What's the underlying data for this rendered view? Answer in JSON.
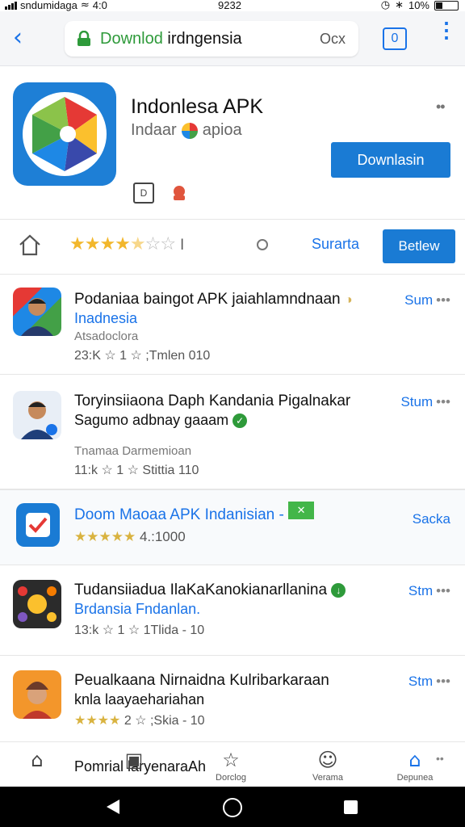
{
  "status": {
    "carrier": "sndumidaga",
    "clock_left": "4:0",
    "clock_center": "9232",
    "battery": "10%"
  },
  "address_bar": {
    "url_green": "Downlod",
    "url_rest": "irdngensia",
    "suffix": "Ocx",
    "tabs_count": "0"
  },
  "app": {
    "title": "Indonlesa APK",
    "developer": "Indaar",
    "developer_tag": "apioa",
    "download_label": "Downlasin",
    "icon_colors": [
      "#1e7fd6",
      "#e53935",
      "#43a047",
      "#fbc02d",
      "#3949ab"
    ]
  },
  "rating": {
    "stars": "★★★★",
    "half": "★",
    "empty": "☆☆",
    "count": "l",
    "link_label": "Surarta",
    "review_label": "Betlew"
  },
  "list": [
    {
      "title": "Podaniaa baingot APK jaiahlamndnaan",
      "line2": "Inadnesia",
      "line3": "Atsadoclora",
      "line4": "23:K ☆ 1 ☆ ;Tmlen 010",
      "action": "Sum",
      "dots": "•••"
    },
    {
      "title": "Toryinsiiaona Daph Kandania Pigalnakar",
      "line2": "Sagumo adbnay gaaam",
      "line3": "Tnamaa Darmemioan",
      "line4": "11:k ☆ 1 ☆ Stittia 110",
      "action": "Stum",
      "dots": "•••"
    },
    {
      "title": "Doom Maoaa APK Indanisian -",
      "line2_stars": "★★★★★",
      "line2_text": "4.:1000",
      "action": "Sacka"
    },
    {
      "title": "Tudansiiadua IlaKaKanokianarllanina",
      "line2": "Brdansia Fndanlan.",
      "line4": "13:k ☆ 1 ☆ 1Tlida - 10",
      "action": "Stm",
      "dots": "•••"
    },
    {
      "title": "Peualkaana Nirnaidna Kulribarkaraan",
      "line2": "knla laayaehariahan",
      "line4_stars": "★★★★",
      "line4": "2 ☆ ;Skia - 10",
      "action": "Stm",
      "dots": "•••"
    }
  ],
  "bottom_nav": {
    "partial_title": "Pomrial laryenaraAh",
    "items": [
      "",
      "Dorclog",
      "Verama",
      "Depunea"
    ],
    "dots": "••"
  }
}
